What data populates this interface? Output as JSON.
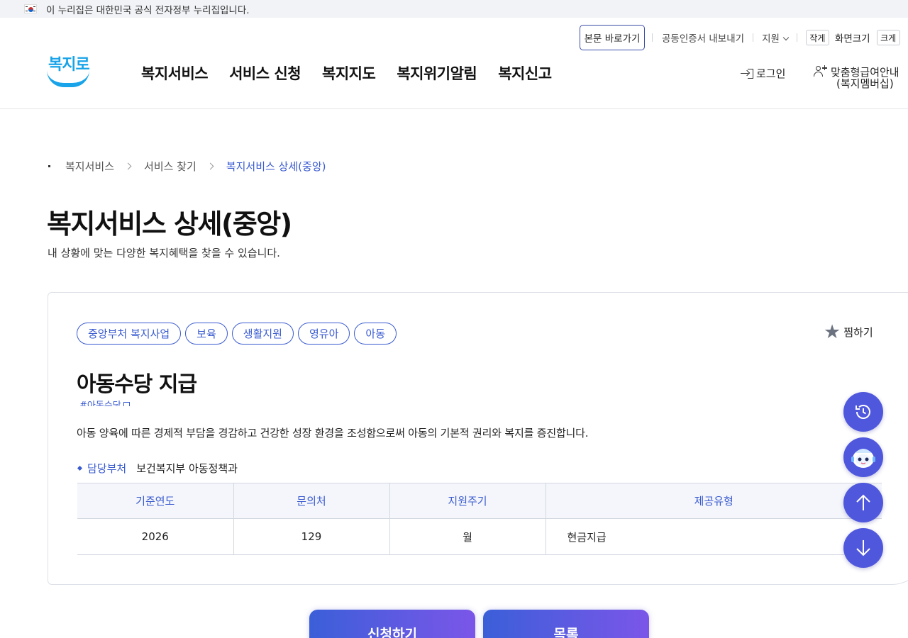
{
  "gov_banner": {
    "flag_icon": "korea-flag-icon",
    "text": "이 누리집은 대한민국 공식 전자정부 누리집입니다."
  },
  "utility": {
    "skip_link": "본문 바로가기",
    "cert_export": "공동인증서 내보내기",
    "support": "지원",
    "font_small": "작게",
    "font_size_label": "화면크기",
    "font_large": "크게"
  },
  "logo": {
    "text": "복지로",
    "accent_color": "#19a3e8"
  },
  "nav": {
    "items": [
      "복지서비스",
      "서비스 신청",
      "복지지도",
      "복지위기알림",
      "복지신고"
    ]
  },
  "account": {
    "login": "로그인",
    "member_line1": "맞춤형급여안내",
    "member_line2": "(복지멤버십)"
  },
  "breadcrumb": {
    "items": [
      "복지서비스",
      "서비스 찾기",
      "복지서비스 상세(중앙)"
    ]
  },
  "page": {
    "title": "복지서비스 상세(중앙)",
    "subtitle": "내 상황에 맞는 다양한 복지혜택을 찾을 수 있습니다."
  },
  "service": {
    "tags": [
      "중앙부처 복지사업",
      "보육",
      "생활지원",
      "영유아",
      "아동"
    ],
    "favorite": "찜하기",
    "title": "아동수당 지급",
    "hashtag": "#아동수당",
    "description": "아동 양육에 따른 경제적 부담을 경감하고 건강한 성장 환경을 조성함으로써 아동의 기본적 권리와 복지를 증진합니다.",
    "dept_label": "담당부처",
    "dept_value": "보건복지부 아동정책과",
    "table": {
      "headers": [
        "기준연도",
        "문의처",
        "지원주기",
        "제공유형"
      ],
      "row": [
        "2026",
        "129",
        "월",
        "현금지급"
      ]
    }
  },
  "actions": {
    "apply": "신청하기",
    "list": "목록"
  },
  "colors": {
    "primary": "#3a5bd0",
    "fab": "#4f57dd"
  }
}
